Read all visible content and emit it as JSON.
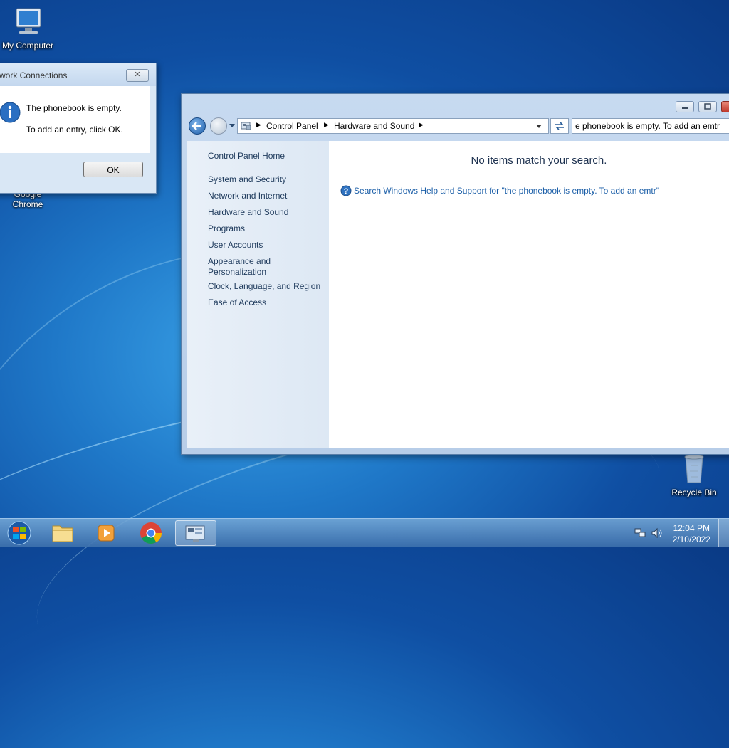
{
  "desktop": {
    "icons": [
      {
        "label": "My Computer"
      },
      {
        "label": "Google Chrome"
      },
      {
        "label": "Recycle Bin"
      }
    ]
  },
  "dialog": {
    "title": "Network Connections",
    "title_visible": "work Connections",
    "message_line1": "The phonebook is empty.",
    "message_line2": "To add an entry, click OK.",
    "ok_label": "OK",
    "close_glyph": "✕"
  },
  "explorer": {
    "breadcrumb": [
      "Control Panel",
      "Hardware and Sound"
    ],
    "search_value": "e phonebook is empty. To add an emtr",
    "nav": {
      "home": "Control Panel Home",
      "items": [
        "System and Security",
        "Network and Internet",
        "Hardware and Sound",
        "Programs",
        "User Accounts",
        "Appearance and Personalization",
        "Clock, Language, and Region",
        "Ease of Access"
      ]
    },
    "no_items_text": "No items match your search.",
    "help_link_text": "Search Windows Help and Support for \"the phonebook is empty. To add an emtr\""
  },
  "taskbar": {
    "time": "12:04 PM",
    "date": "2/10/2022"
  },
  "colors": {
    "accent": "#1c5fa8",
    "close_red": "#c0392b"
  }
}
